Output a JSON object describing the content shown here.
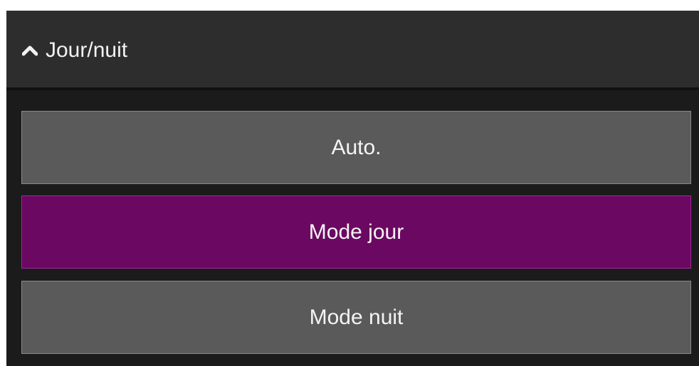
{
  "section": {
    "title": "Jour/nuit",
    "icon": "chevron-up-icon"
  },
  "options": [
    {
      "label": "Auto.",
      "selected": false
    },
    {
      "label": "Mode jour",
      "selected": true
    },
    {
      "label": "Mode nuit",
      "selected": false
    }
  ],
  "colors": {
    "panel_bg": "#1b1b1b",
    "header_bg": "#2d2d2d",
    "button_bg": "#5a5a5a",
    "selected_bg": "#6b0962",
    "text": "#f4f4f4"
  }
}
